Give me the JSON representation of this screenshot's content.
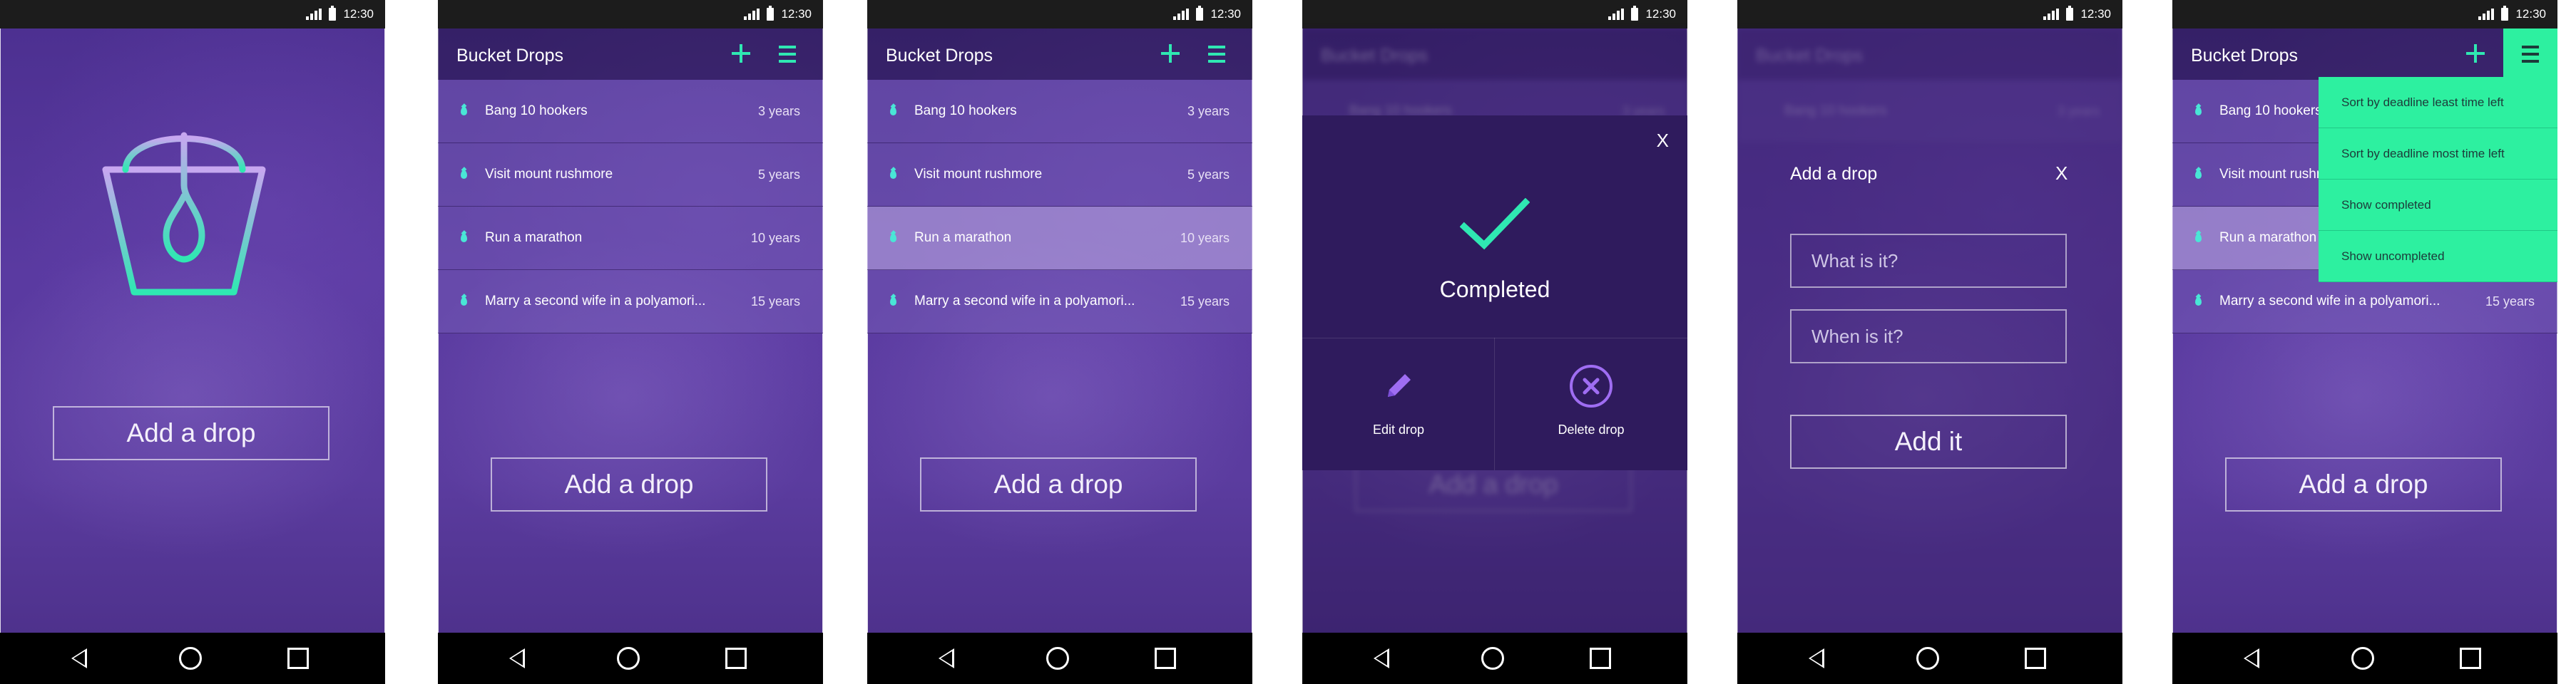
{
  "status_bar": {
    "time": "12:30"
  },
  "app_title": "Bucket Drops",
  "add_drop_label": "Add a drop",
  "drops": [
    {
      "title": "Bang 10 hookers",
      "due": "3 years"
    },
    {
      "title": "Visit mount rushmore",
      "due": "5 years"
    },
    {
      "title": "Run a marathon",
      "due": "10 years"
    },
    {
      "title": "Marry a second wife in a polyamori...",
      "due": "15 years"
    }
  ],
  "completed_dialog": {
    "close": "X",
    "status": "Completed",
    "edit_label": "Edit drop",
    "delete_label": "Delete drop"
  },
  "add_dialog": {
    "title": "Add a drop",
    "close": "X",
    "what_placeholder": "What is it?",
    "when_placeholder": "When is it?",
    "submit_label": "Add it"
  },
  "sort_menu": [
    "Sort by deadline least time left",
    "Sort by deadline most time left",
    "Show completed",
    "Show uncompleted"
  ],
  "colors": {
    "accent": "#2fe8b2",
    "menu_bg": "#2df0a0",
    "drop": "#49e6d6",
    "background": "#5a3aa1"
  },
  "icons": [
    "signal-icon",
    "battery-icon",
    "plus-icon",
    "menu-icon",
    "drop-icon",
    "checkmark-icon",
    "pencil-icon",
    "delete-circle-icon",
    "back-icon",
    "home-icon",
    "recent-apps-icon",
    "bucket-logo-icon"
  ]
}
